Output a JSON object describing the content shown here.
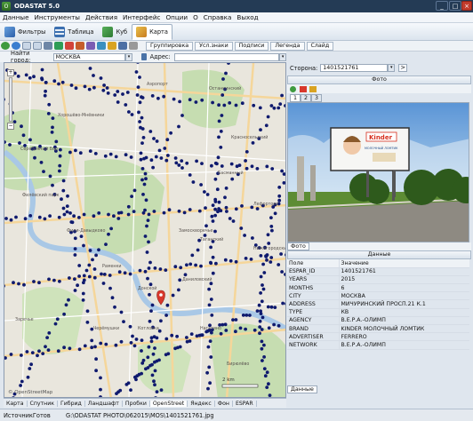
{
  "window": {
    "title": "ODASTAT 5.0",
    "controls": [
      "_",
      "□",
      "×"
    ]
  },
  "menu": [
    "Данные",
    "Инструменты",
    "Действия",
    "Интерфейс",
    "Опции",
    "О",
    "Справка",
    "Выход"
  ],
  "main_tabs": [
    {
      "label": "Фильтры",
      "icon": "filter-icon"
    },
    {
      "label": "Таблица",
      "icon": "table-icon"
    },
    {
      "label": "Куб",
      "icon": "cube-icon"
    },
    {
      "label": "Карта",
      "icon": "map-icon",
      "active": true
    }
  ],
  "map_toolbar": {
    "buttons": [
      "Группировка",
      "Усл.знаки",
      "Подписи",
      "Легенда",
      "Слайд"
    ]
  },
  "find": {
    "city_label": "Найти город:",
    "city_value": "МОСКВА",
    "address_label": "Адрес:",
    "address_value": ""
  },
  "map": {
    "place_labels": [
      "Серебряный Бор",
      "Хорошёво-Мнёвники",
      "Филёвский парк",
      "Фили-Давыдково",
      "Раменки",
      "Замоскворечье",
      "Бирюлёво",
      "Заречье",
      "Аэропорт",
      "Останкинский",
      "Красносельский",
      "Басманный",
      "Лефортово",
      "Нижегородский",
      "Таганский",
      "Донской",
      "Даниловский",
      "Нагатино",
      "Котловка",
      "Черёмушки"
    ],
    "scale_text": "2 km",
    "copyright": "© OpenStreetMap"
  },
  "map_sources": [
    "Карта",
    "Спутник",
    "Гибрид",
    "Ландшафт",
    "Пробки",
    "OpenStreet",
    "Яндекс",
    "Фон",
    "ESPAR"
  ],
  "selected_map_source": "OpenStreet",
  "side_panel": {
    "side_label": "Сторона:",
    "side_value": "1401521761",
    "side_button": ">",
    "photo_header": "Фото",
    "photo_tabs": [
      "1",
      "2",
      "3"
    ],
    "photo_tab_label": "Фото",
    "data_header": "Данные",
    "columns": [
      "Поле",
      "Значение"
    ],
    "rows": [
      [
        "ESPAR_ID",
        "1401521761"
      ],
      [
        "YEARS",
        "2015"
      ],
      [
        "MONTHS",
        "6"
      ],
      [
        "CITY",
        "МОСКВА"
      ],
      [
        "ADDRESS",
        "МИЧУРИНСКИЙ ПРОСП.21 К.1"
      ],
      [
        "TYPE",
        "КВ"
      ],
      [
        "AGENCY",
        "В.Е.Р.А.-ОЛИМП"
      ],
      [
        "BRAND",
        "KINDER МОЛОЧНЫЙ ЛОМТИК"
      ],
      [
        "ADVERTISER",
        "FERRERO"
      ],
      [
        "NETWORK",
        "В.Е.Р.А.-ОЛИМП"
      ]
    ],
    "bottom_tab": "Данные"
  },
  "billboard": {
    "brand": "Kinder",
    "slogan": "МОЛОЧНЫЙ ЛОМТИК"
  },
  "status": {
    "left": "ИсточникГотов",
    "path": "G:\\ODASTAT PHOTO\\062015\\MOS\\1401521761.jpg"
  },
  "colors": {
    "title_bg": "#243b55",
    "dot": "#0f1a6e",
    "marker": "#d8382c",
    "map_green": "#c6ddb1",
    "map_bg": "#e9e6dd"
  }
}
